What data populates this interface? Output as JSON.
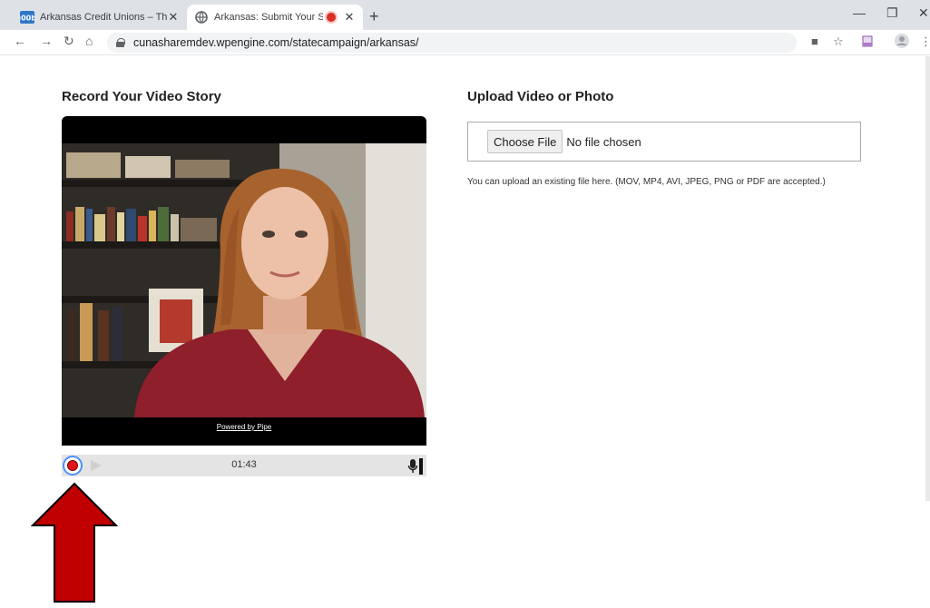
{
  "browser": {
    "tabs": [
      {
        "title": "Arkansas Credit Unions – The Rig",
        "active": false
      },
      {
        "title": "Arkansas: Submit Your Story",
        "active": true,
        "recording": true
      }
    ],
    "url": "cunasharemdev.wpengine.com/statecampaign/arkansas/"
  },
  "page": {
    "record_section": {
      "heading": "Record Your Video Story",
      "powered_by": "Powered by Pipe",
      "timer": "01:43"
    },
    "upload_section": {
      "heading": "Upload Video or Photo",
      "choose_label": "Choose File",
      "file_status": "No file chosen",
      "help_text": "You can upload an existing file here. (MOV, MP4, AVI, JPEG, PNG or PDF are accepted.)"
    }
  },
  "colors": {
    "record_red": "#e0161f",
    "annotation_arrow": "#c00000",
    "focus_blue": "#4d90fe"
  }
}
